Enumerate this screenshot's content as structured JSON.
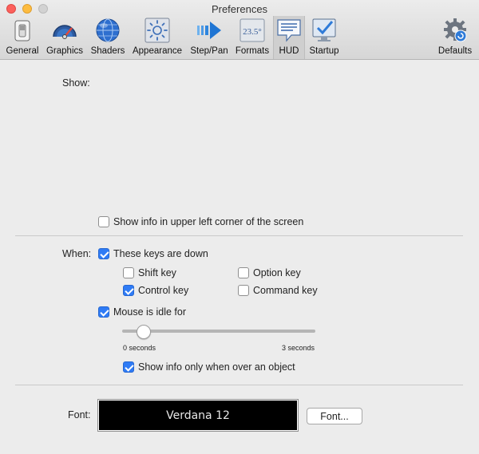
{
  "window": {
    "title": "Preferences"
  },
  "toolbar": {
    "items": [
      {
        "label": "General",
        "icon": "general-switch-icon"
      },
      {
        "label": "Graphics",
        "icon": "speedometer-icon"
      },
      {
        "label": "Shaders",
        "icon": "globe-icon"
      },
      {
        "label": "Appearance",
        "icon": "brightness-icon"
      },
      {
        "label": "Step/Pan",
        "icon": "arrow-right-icon"
      },
      {
        "label": "Formats",
        "icon": "formats-icon",
        "icon_text": "23.5°"
      },
      {
        "label": "HUD",
        "icon": "hud-speech-icon",
        "selected": true
      },
      {
        "label": "Startup",
        "icon": "monitor-check-icon"
      },
      {
        "label": "Defaults",
        "icon": "gear-reset-icon"
      }
    ]
  },
  "show_section": {
    "label": "Show:",
    "upper_left": {
      "label": "Show info in upper left corner of the screen",
      "checked": false
    }
  },
  "when_section": {
    "label": "When:",
    "keys_down": {
      "label": "These keys are down",
      "checked": true
    },
    "shift": {
      "label": "Shift key",
      "checked": false
    },
    "option": {
      "label": "Option key",
      "checked": false
    },
    "control": {
      "label": "Control key",
      "checked": true
    },
    "command": {
      "label": "Command key",
      "checked": false
    },
    "mouse_idle": {
      "label": "Mouse is idle for",
      "checked": true
    },
    "slider": {
      "min_label": "0 seconds",
      "max_label": "3 seconds",
      "value_fraction": 0.08
    },
    "over_object": {
      "label": "Show info only when over an object",
      "checked": true
    }
  },
  "font_section": {
    "label": "Font:",
    "preview": "Verdana 12",
    "button": "Font..."
  },
  "colors": {
    "accent": "#2f7bf5",
    "close": "#fc605c",
    "minimize": "#fdbc40"
  }
}
